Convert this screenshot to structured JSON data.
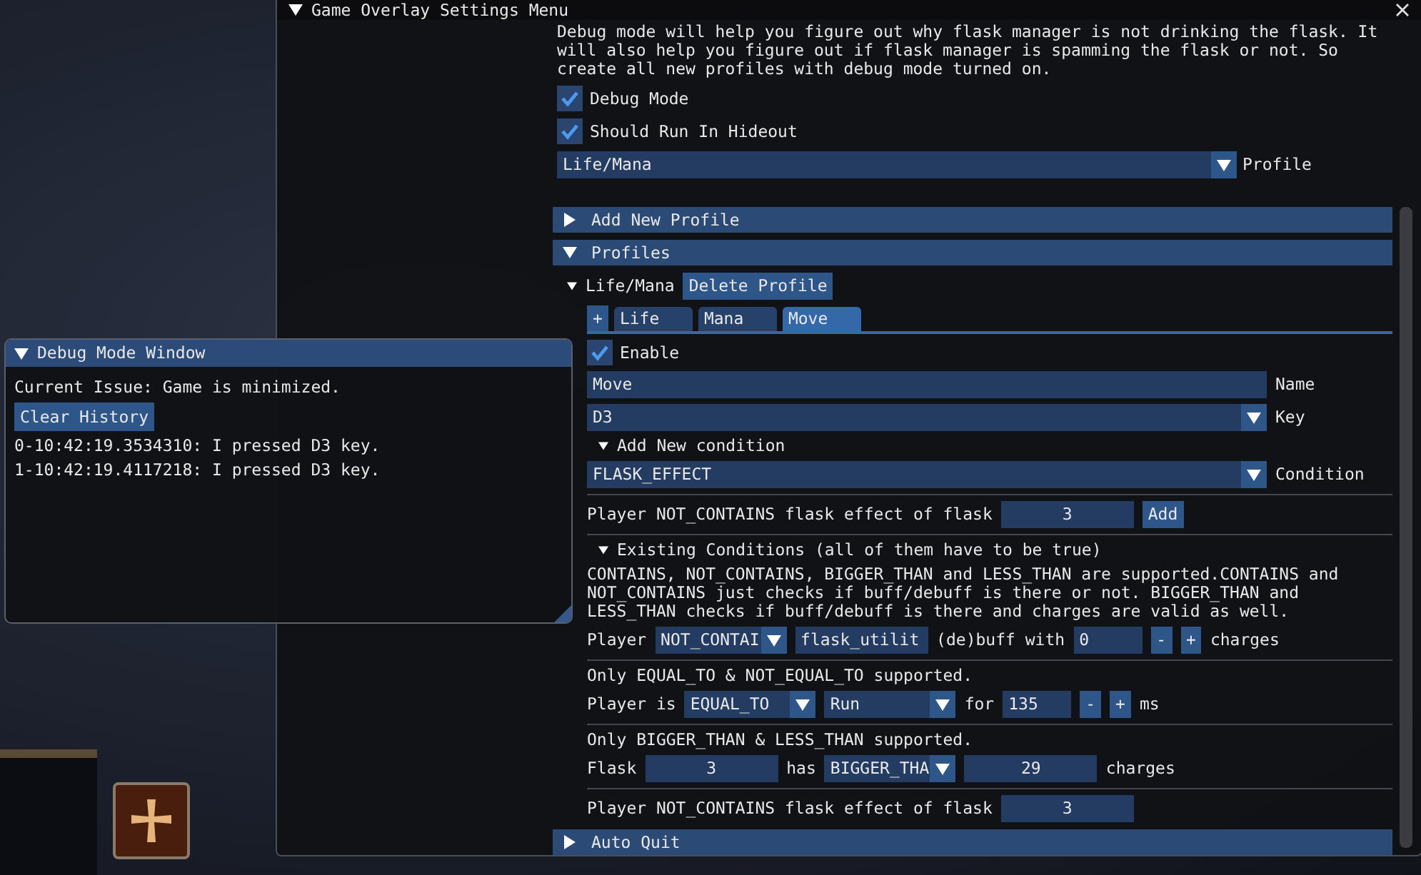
{
  "settings_window": {
    "title": "Game Overlay Settings Menu",
    "expanded": true,
    "description": "Debug mode will help you figure out why flask manager is not drinking the flask. It will also help you figure out if flask manager is spamming the flask or not. So create all new profiles with debug mode turned on.",
    "options": [
      {
        "label": "Debug Mode",
        "checked": true
      },
      {
        "label": "Should Run In Hideout",
        "checked": true
      }
    ],
    "profile_dropdown": {
      "value": "Life/Mana",
      "label": "Profile"
    },
    "add_new_profile": {
      "label": "Add New Profile",
      "expanded": false
    },
    "profiles": {
      "label": "Profiles",
      "expanded": true,
      "profile": {
        "name": "Life/Mana",
        "expanded": true,
        "delete_button": "Delete Profile",
        "add_tab_button": "+",
        "tabs": [
          {
            "label": "Life",
            "selected": false
          },
          {
            "label": "Mana",
            "selected": false
          },
          {
            "label": "Move",
            "selected": true
          }
        ],
        "enable": {
          "label": "Enable",
          "checked": true
        },
        "name_field": {
          "value": "Move",
          "label": "Name"
        },
        "key_dropdown": {
          "value": "D3",
          "label": "Key"
        },
        "add_condition": {
          "label": "Add New condition",
          "expanded": true,
          "condition_dropdown": {
            "value": "FLASK_EFFECT",
            "label": "Condition"
          },
          "editor": [
            {
              "kind": "text",
              "text": "Player NOT_CONTAINS flask effect of flask"
            },
            {
              "kind": "number",
              "text": "3"
            },
            {
              "kind": "button",
              "text": "Add"
            }
          ]
        },
        "existing": {
          "label": "Existing Conditions (all of them have to be true)",
          "expanded": true,
          "conditions": [
            {
              "help": "CONTAINS, NOT_CONTAINS, BIGGER_THAN and LESS_THAN are supported.CONTAINS and NOT_CONTAINS just checks if buff/debuff is there or not. BIGGER_THAN and LESS_THAN checks if buff/debuff is there and charges are valid as well.",
              "items": [
                {
                  "kind": "text",
                  "text": "Player"
                },
                {
                  "kind": "dropdown",
                  "text": "NOT_CONTAI"
                },
                {
                  "kind": "field",
                  "text": "flask_utilit"
                },
                {
                  "kind": "text",
                  "text": "(de)buff with"
                },
                {
                  "kind": "spin",
                  "text": "0"
                },
                {
                  "kind": "button",
                  "text": "-"
                },
                {
                  "kind": "button",
                  "text": "+"
                },
                {
                  "kind": "text",
                  "text": "charges"
                }
              ]
            },
            {
              "help": "Only EQUAL_TO & NOT_EQUAL_TO supported.",
              "items": [
                {
                  "kind": "text",
                  "text": "Player is"
                },
                {
                  "kind": "dropdown",
                  "text": "EQUAL_TO"
                },
                {
                  "kind": "dropdown",
                  "text": "Run"
                },
                {
                  "kind": "text",
                  "text": "for"
                },
                {
                  "kind": "spin",
                  "text": "135"
                },
                {
                  "kind": "button",
                  "text": "-"
                },
                {
                  "kind": "button",
                  "text": "+"
                },
                {
                  "kind": "text",
                  "text": "ms"
                }
              ]
            },
            {
              "help": "Only BIGGER_THAN & LESS_THAN supported.",
              "items": [
                {
                  "kind": "text",
                  "text": "Flask"
                },
                {
                  "kind": "number",
                  "text": "3"
                },
                {
                  "kind": "text",
                  "text": "has"
                },
                {
                  "kind": "dropdown",
                  "text": "BIGGER_THA"
                },
                {
                  "kind": "number",
                  "text": "29"
                },
                {
                  "kind": "text",
                  "text": "charges"
                }
              ]
            },
            {
              "items": [
                {
                  "kind": "text",
                  "text": "Player NOT_CONTAINS flask effect of flask"
                },
                {
                  "kind": "number",
                  "text": "3"
                }
              ]
            }
          ]
        }
      }
    },
    "auto_quit": {
      "label": "Auto Quit",
      "expanded": false
    }
  },
  "debug_window": {
    "title": "Debug Mode Window",
    "expanded": true,
    "current_issue": "Current Issue: Game is minimized.",
    "clear_button": "Clear History",
    "log": [
      "0-10:42:19.3534310: I pressed D3 key.",
      "1-10:42:19.4117218: I pressed D3 key."
    ]
  }
}
